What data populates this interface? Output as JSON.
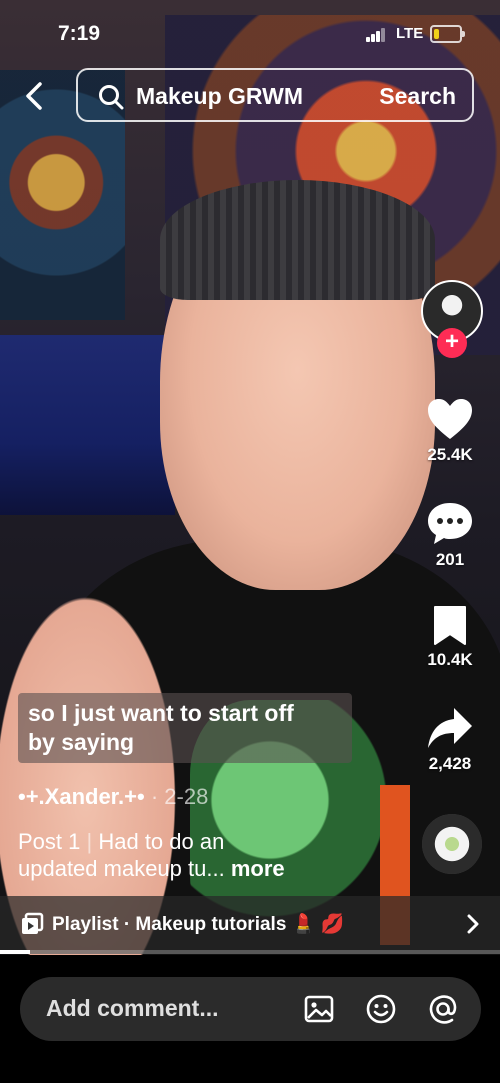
{
  "status_bar": {
    "time": "7:19",
    "network": "LTE",
    "battery_level": 0.22,
    "battery_color": "#f0d21a"
  },
  "search": {
    "query": "Makeup GRWM",
    "button_label": "Search"
  },
  "actions": {
    "likes": "25.4K",
    "comments": "201",
    "saves": "10.4K",
    "shares": "2,428"
  },
  "caption": {
    "line1": "so I just want to start off",
    "line2": "by saying"
  },
  "creator": {
    "name": "•+.Xander.+•",
    "date": "· 2-28"
  },
  "description": {
    "prefix": "Post 1",
    "separator": "|",
    "line1_rest": "Had to do an",
    "line2": "updated makeup tu...",
    "more": "more"
  },
  "playlist": {
    "label": "Playlist · Makeup tutorials 💄 💋"
  },
  "playback_progress": 0.06,
  "comment_box": {
    "placeholder": "Add comment..."
  },
  "colors": {
    "accent_follow": "#fe2c55"
  },
  "icons": [
    "back-arrow-icon",
    "search-icon",
    "heart-icon",
    "comment-bubble-icon",
    "bookmark-icon",
    "share-arrow-icon",
    "playlist-icon",
    "chevron-right-icon",
    "image-icon",
    "emoji-icon",
    "mention-icon"
  ]
}
